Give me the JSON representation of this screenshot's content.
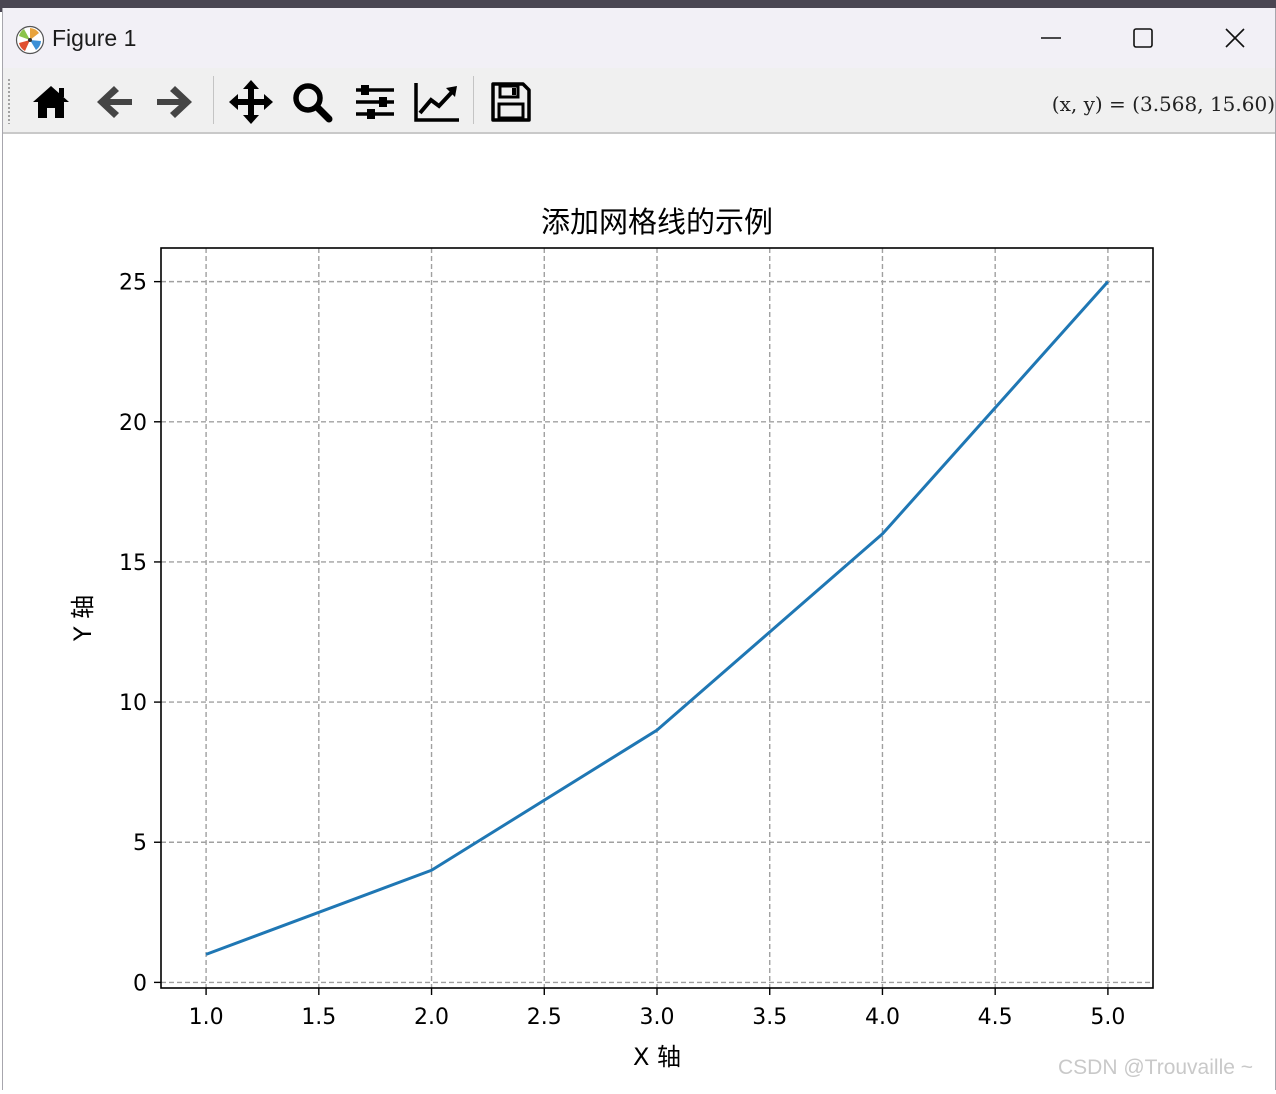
{
  "window": {
    "title": "Figure 1",
    "controls": {
      "minimize": "minimize",
      "maximize": "maximize",
      "close": "close"
    }
  },
  "toolbar": {
    "buttons": [
      {
        "name": "home",
        "icon": "home-icon"
      },
      {
        "name": "back",
        "icon": "arrow-left-icon"
      },
      {
        "name": "forward",
        "icon": "arrow-right-icon"
      },
      {
        "name": "pan",
        "icon": "move-icon"
      },
      {
        "name": "zoom",
        "icon": "magnifier-icon"
      },
      {
        "name": "configure-subplots",
        "icon": "sliders-icon"
      },
      {
        "name": "edit-axis",
        "icon": "line-chart-icon"
      },
      {
        "name": "save",
        "icon": "floppy-disk-icon"
      }
    ],
    "coords_text": "(x, y) = (3.568, 15.60)"
  },
  "chart_data": {
    "type": "line",
    "title": "添加网格线的示例",
    "xlabel": "X 轴",
    "ylabel": "Y 轴",
    "x": [
      1,
      2,
      3,
      4,
      5
    ],
    "series": [
      {
        "values": [
          1,
          4,
          9,
          16,
          25
        ],
        "color": "#1f77b4"
      }
    ],
    "xlim": [
      0.8,
      5.2
    ],
    "ylim": [
      -0.2,
      26.2
    ],
    "xticks": [
      1.0,
      1.5,
      2.0,
      2.5,
      3.0,
      3.5,
      4.0,
      4.5,
      5.0
    ],
    "xtick_labels": [
      "1.0",
      "1.5",
      "2.0",
      "2.5",
      "3.0",
      "3.5",
      "4.0",
      "4.5",
      "5.0"
    ],
    "yticks": [
      0,
      5,
      10,
      15,
      20,
      25
    ],
    "ytick_labels": [
      "0",
      "5",
      "10",
      "15",
      "20",
      "25"
    ],
    "grid": true,
    "grid_style": "dashed",
    "grid_color": "#a0a0a0"
  },
  "watermark": "CSDN @Trouvaille ~"
}
